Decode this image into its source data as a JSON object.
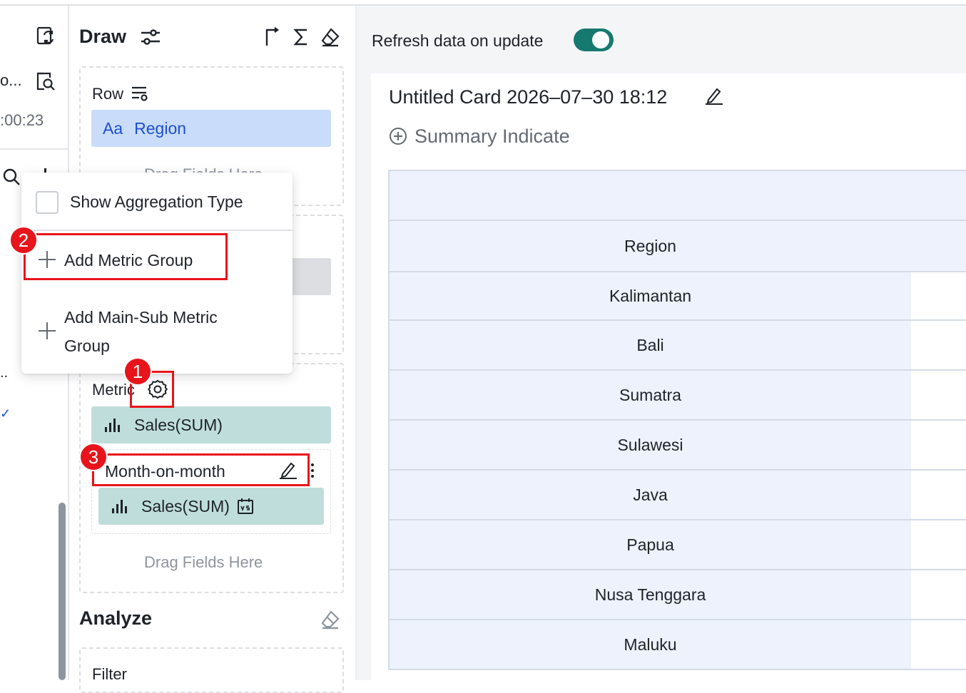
{
  "left": {
    "truncated_name": "o...",
    "time": ":00:23",
    "dots": "..",
    "check": "✓"
  },
  "draw": {
    "title": "Draw",
    "row_label": "Row",
    "row_field": "Region",
    "row_field_type": "Aa",
    "row_drag_hint": "Drag Fields Here",
    "metric_label": "Metric",
    "metric_field": "Sales(SUM)",
    "group_title": "Month-on-month",
    "group_field": "Sales(SUM)",
    "metric_drag_hint": "Drag Fields Here"
  },
  "analyze": {
    "title": "Analyze",
    "filter_label": "Filter"
  },
  "popup": {
    "show_aggregation": "Show Aggregation Type",
    "add_metric_group": "Add Metric Group",
    "add_main_sub_line1": "Add Main-Sub Metric",
    "add_main_sub_line2": "Group"
  },
  "annotations": {
    "b1": "1",
    "b2": "2",
    "b3": "3"
  },
  "right": {
    "refresh_label": "Refresh data on update",
    "card_title": "Untitled Card 2026–07–30 18:12",
    "summary": "Summary Indicate"
  },
  "table": {
    "header": "Region",
    "rows": [
      "Kalimantan",
      "Bali",
      "Sumatra",
      "Sulawesi",
      "Java",
      "Papua",
      "Nusa Tenggara",
      "Maluku"
    ]
  },
  "colors": {
    "accent_teal": "#16796f",
    "highlight_red": "#e8141b",
    "field_blue": "#c9dcfa",
    "field_teal": "#bfdedb"
  }
}
